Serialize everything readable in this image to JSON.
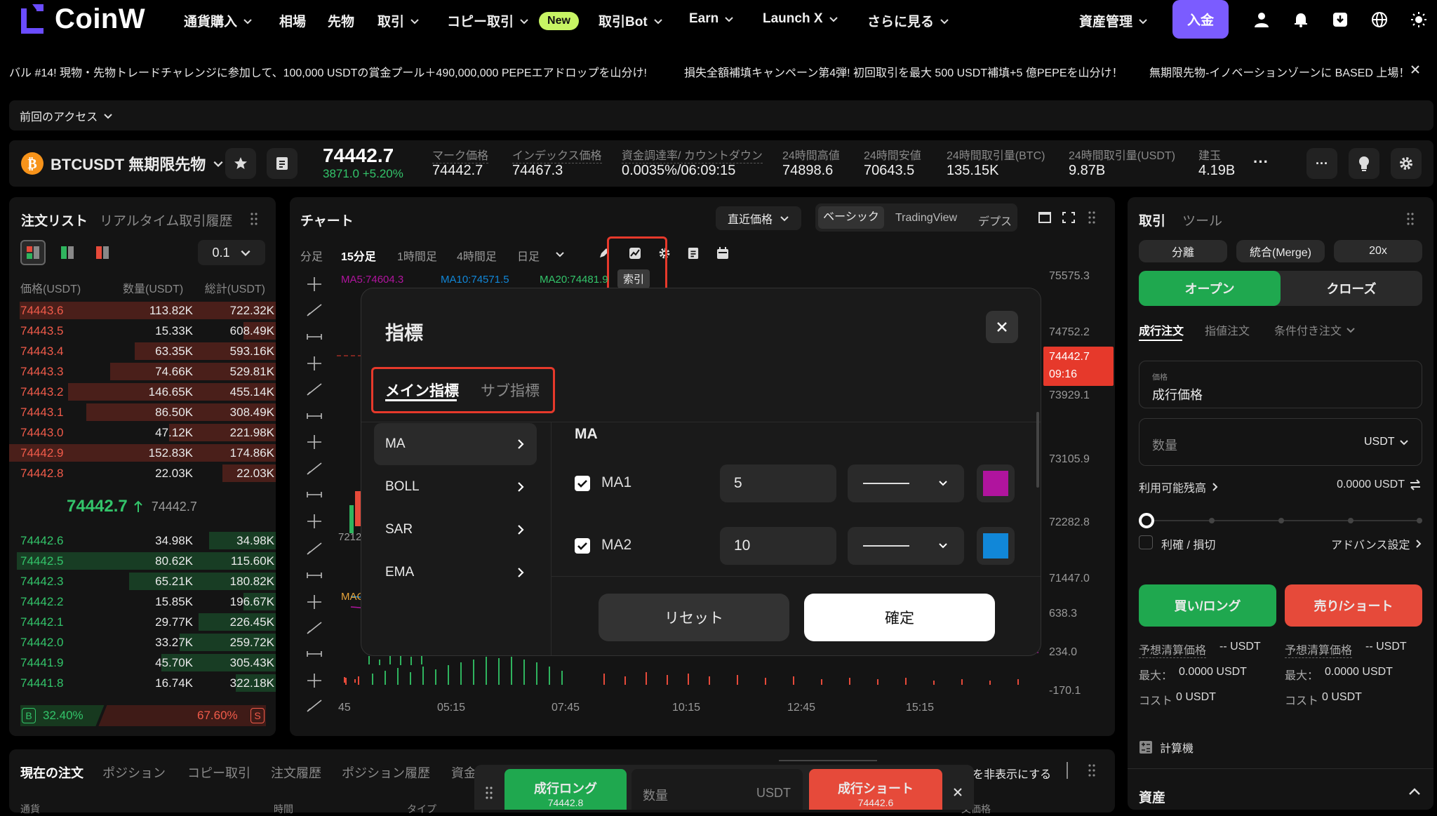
{
  "brand": {
    "name": "CoinW"
  },
  "nav": {
    "items": [
      {
        "label": "通貨購入",
        "dropdown": true
      },
      {
        "label": "相場",
        "dropdown": false
      },
      {
        "label": "先物",
        "dropdown": false
      },
      {
        "label": "取引",
        "dropdown": true
      },
      {
        "label": "コピー取引",
        "dropdown": true
      },
      {
        "label": "取引Bot",
        "dropdown": true
      },
      {
        "label": "Earn",
        "dropdown": true
      },
      {
        "label": "Launch X",
        "dropdown": true
      },
      {
        "label": "さらに見る",
        "dropdown": true
      }
    ],
    "new_badge": "New",
    "asset_mgmt": "資産管理",
    "deposit": "入金"
  },
  "ticker": {
    "items": [
      "バル #14! 現物・先物トレードチャレンジに参加して、100,000 USDTの賞金プール＋490,000,000 PEPEエアドロップを山分け!",
      "損失全額補填キャンペーン第4弾! 初回取引を最大 500 USDT補填+5 億PEPEを山分け！",
      "無期限先物-イノベーションゾーンに BASED 上場！"
    ]
  },
  "recent_access": "前回のアクセス",
  "symbol": {
    "name": "BTCUSDT 無期限先物",
    "last_price": "74442.7",
    "change": "3871.0 +5.20%",
    "stats": [
      {
        "label": "マーク価格",
        "value": "74442.7",
        "dashed": true
      },
      {
        "label": "インデックス価格",
        "value": "74467.3",
        "dashed": true
      },
      {
        "label": "資金調達率/ カウントダウン",
        "value": "0.0035%/06:09:15",
        "dashed": true
      },
      {
        "label": "24時間高値",
        "value": "74898.6",
        "dashed": false
      },
      {
        "label": "24時間安値",
        "value": "70643.5",
        "dashed": false
      },
      {
        "label": "24時間取引量(BTC)",
        "value": "135.15K",
        "dashed": false
      },
      {
        "label": "24時間取引量(USDT)",
        "value": "9.87B",
        "dashed": false
      },
      {
        "label": "建玉",
        "value": "4.19B",
        "dashed": false
      }
    ]
  },
  "orderbook": {
    "title": "注文リスト",
    "tab2": "リアルタイム取引履歴",
    "precision": "0.1",
    "headers": [
      "価格(USDT)",
      "数量(USDT)",
      "総計(USDT)"
    ],
    "asks": [
      {
        "p": "74443.6",
        "q": "113.82K",
        "t": "722.32K",
        "depth": 0.96
      },
      {
        "p": "74443.5",
        "q": "15.33K",
        "t": "608.49K",
        "depth": 0.12
      },
      {
        "p": "74443.4",
        "q": "63.35K",
        "t": "593.16K",
        "depth": 0.53
      },
      {
        "p": "74443.3",
        "q": "74.66K",
        "t": "529.81K",
        "depth": 0.62
      },
      {
        "p": "74443.2",
        "q": "146.65K",
        "t": "455.14K",
        "depth": 0.78
      },
      {
        "p": "74443.1",
        "q": "86.50K",
        "t": "308.49K",
        "depth": 0.71
      },
      {
        "p": "74443.0",
        "q": "47.12K",
        "t": "221.98K",
        "depth": 0.4
      },
      {
        "p": "74442.9",
        "q": "152.83K",
        "t": "174.86K",
        "depth": 1.0
      },
      {
        "p": "74442.8",
        "q": "22.03K",
        "t": "22.03K",
        "depth": 0.2
      }
    ],
    "mid_price": "74442.7",
    "mid_mark": "74442.7",
    "bids": [
      {
        "p": "74442.6",
        "q": "34.98K",
        "t": "34.98K",
        "depth": 0.25
      },
      {
        "p": "74442.5",
        "q": "80.62K",
        "t": "115.60K",
        "depth": 0.97
      },
      {
        "p": "74442.3",
        "q": "65.21K",
        "t": "180.82K",
        "depth": 0.55
      },
      {
        "p": "74442.2",
        "q": "15.85K",
        "t": "196.67K",
        "depth": 0.12
      },
      {
        "p": "74442.1",
        "q": "29.77K",
        "t": "226.45K",
        "depth": 0.29
      },
      {
        "p": "74442.0",
        "q": "33.27K",
        "t": "259.72K",
        "depth": 0.36
      },
      {
        "p": "74441.9",
        "q": "45.70K",
        "t": "305.43K",
        "depth": 0.43
      },
      {
        "p": "74441.8",
        "q": "16.74K",
        "t": "322.18K",
        "depth": 0.15
      }
    ],
    "buy_ratio": "32.40%",
    "sell_ratio": "67.60%",
    "buy_letter": "B",
    "sell_letter": "S"
  },
  "chart": {
    "title": "チャート",
    "price_type": "直近価格",
    "modes": [
      "ベーシック",
      "TradingView",
      "デプス"
    ],
    "timeframes": [
      "分足",
      "15分足",
      "1時間足",
      "4時間足",
      "日足"
    ],
    "active_tf": "15分足",
    "ma_labels": [
      "MA5:74604.3",
      "MA10:74571.5",
      "MA20:74481.9"
    ],
    "tooltip": "索引",
    "y_labels": [
      "75575.3",
      "74752.2",
      "73929.1",
      "73105.9",
      "72282.8",
      "71447.0",
      "638.3",
      "234.0",
      "-170.1"
    ],
    "x_labels": [
      "45",
      "05:15",
      "07:45",
      "10:15",
      "12:45",
      "15:15"
    ],
    "price_tag": "74442.7",
    "price_tag_time": "09:16",
    "partial_a": "7212",
    "partial_b": "MAC"
  },
  "indicator_modal": {
    "title": "指標",
    "tabs": [
      "メイン指標",
      "サブ指標"
    ],
    "list": [
      "MA",
      "BOLL",
      "SAR",
      "EMA"
    ],
    "section": "MA",
    "rows": [
      {
        "label": "MA1",
        "value": "5",
        "color": "#b0149e"
      },
      {
        "label": "MA2",
        "value": "10",
        "color": "#1187d8"
      }
    ],
    "reset": "リセット",
    "confirm": "確定"
  },
  "trade": {
    "tab1": "取引",
    "tab2": "ツール",
    "mode1": "分離",
    "mode2": "統合(Merge)",
    "leverage": "20x",
    "open": "オープン",
    "close": "クローズ",
    "order_types": [
      "成行注文",
      "指値注文",
      "条件付き注文"
    ],
    "price_label": "価格",
    "price_value": "成行価格",
    "qty_placeholder": "数量",
    "qty_unit": "USDT",
    "available_label": "利用可能残高",
    "available_value": "0.0000 USDT",
    "tpsl": "利確 / 損切",
    "advanced": "アドバンス設定",
    "buy_long": "買い/ロング",
    "sell_short": "売り/ショート",
    "est_liq_label": "予想清算価格",
    "est_liq_value": "-- USDT",
    "max_label": "最大：",
    "max_value": "0.0000 USDT",
    "cost_label": "コスト",
    "cost_value": "0 USDT",
    "calculator": "計算機",
    "assets": "資産"
  },
  "bottom": {
    "tabs": [
      "現在の注文",
      "ポジション",
      "コピー取引",
      "注文履歴",
      "ポジション履歴",
      "資金"
    ],
    "hide_text": "約を非表示にする",
    "col_a": "通貨",
    "col_b": "時間",
    "col_c": "タイプ",
    "col_d": "文価格"
  },
  "quickbar": {
    "long_label": "成行ロング",
    "long_price": "74442.8",
    "qty_placeholder": "数量",
    "unit": "USDT",
    "short_label": "成行ショート",
    "short_price": "74442.6"
  }
}
